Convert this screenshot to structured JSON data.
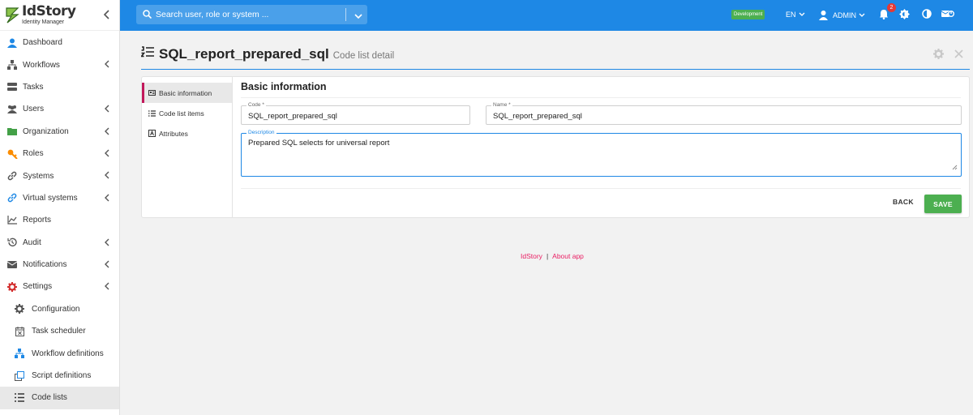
{
  "app": {
    "title": "IdStory",
    "subtitle": "Identity Manager"
  },
  "sidebar": {
    "items": [
      {
        "label": "Dashboard",
        "icon": "dashboard-icon",
        "has_children": false
      },
      {
        "label": "Workflows",
        "icon": "workflow-icon",
        "has_children": true
      },
      {
        "label": "Tasks",
        "icon": "tasks-icon",
        "has_children": false
      },
      {
        "label": "Users",
        "icon": "users-icon",
        "has_children": true
      },
      {
        "label": "Organization",
        "icon": "folder-icon",
        "has_children": true
      },
      {
        "label": "Roles",
        "icon": "key-icon",
        "has_children": true
      },
      {
        "label": "Systems",
        "icon": "link-icon",
        "has_children": true
      },
      {
        "label": "Virtual systems",
        "icon": "link-icon",
        "has_children": true
      },
      {
        "label": "Reports",
        "icon": "chart-icon",
        "has_children": false
      },
      {
        "label": "Audit",
        "icon": "history-icon",
        "has_children": true
      },
      {
        "label": "Notifications",
        "icon": "envelope-icon",
        "has_children": true
      },
      {
        "label": "Settings",
        "icon": "gear-icon",
        "has_children": true
      },
      {
        "label": "Configuration",
        "icon": "gear-icon",
        "sub": true
      },
      {
        "label": "Task scheduler",
        "icon": "calendar-icon",
        "sub": true
      },
      {
        "label": "Workflow definitions",
        "icon": "workflow-icon",
        "sub": true
      },
      {
        "label": "Script definitions",
        "icon": "copy-icon",
        "sub": true
      },
      {
        "label": "Code lists",
        "icon": "list-icon",
        "sub": true,
        "active": true
      }
    ]
  },
  "topbar": {
    "search_placeholder": "Search user, role or system ...",
    "environment": "Development",
    "language": "EN",
    "user": "ADMIN",
    "notification_count": "2"
  },
  "page": {
    "title": "SQL_report_prepared_sql",
    "subtitle": "Code list detail"
  },
  "tabs": [
    {
      "label": "Basic information",
      "icon": "info-icon",
      "active": true
    },
    {
      "label": "Code list items",
      "icon": "list-icon"
    },
    {
      "label": "Attributes",
      "icon": "attribute-icon"
    }
  ],
  "form": {
    "title": "Basic information",
    "code_label": "Code *",
    "code_value": "SQL_report_prepared_sql",
    "name_label": "Name *",
    "name_value": "SQL_report_prepared_sql",
    "description_label": "Description",
    "description_value": "Prepared SQL selects for universal report",
    "back_label": "BACK",
    "save_label": "SAVE"
  },
  "footer": {
    "brand": "IdStory",
    "separator": "|",
    "about": "About app"
  },
  "colors": {
    "primary": "#1e88e5",
    "accent": "#c2185b",
    "save": "#4caf50",
    "badge": "#e53935"
  }
}
